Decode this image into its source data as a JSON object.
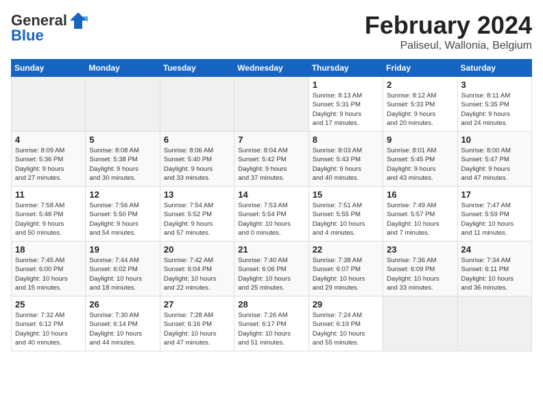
{
  "header": {
    "logo_general": "General",
    "logo_blue": "Blue",
    "month": "February 2024",
    "location": "Paliseul, Wallonia, Belgium"
  },
  "days_of_week": [
    "Sunday",
    "Monday",
    "Tuesday",
    "Wednesday",
    "Thursday",
    "Friday",
    "Saturday"
  ],
  "weeks": [
    [
      {
        "day": "",
        "info": ""
      },
      {
        "day": "",
        "info": ""
      },
      {
        "day": "",
        "info": ""
      },
      {
        "day": "",
        "info": ""
      },
      {
        "day": "1",
        "info": "Sunrise: 8:13 AM\nSunset: 5:31 PM\nDaylight: 9 hours\nand 17 minutes."
      },
      {
        "day": "2",
        "info": "Sunrise: 8:12 AM\nSunset: 5:33 PM\nDaylight: 9 hours\nand 20 minutes."
      },
      {
        "day": "3",
        "info": "Sunrise: 8:11 AM\nSunset: 5:35 PM\nDaylight: 9 hours\nand 24 minutes."
      }
    ],
    [
      {
        "day": "4",
        "info": "Sunrise: 8:09 AM\nSunset: 5:36 PM\nDaylight: 9 hours\nand 27 minutes."
      },
      {
        "day": "5",
        "info": "Sunrise: 8:08 AM\nSunset: 5:38 PM\nDaylight: 9 hours\nand 30 minutes."
      },
      {
        "day": "6",
        "info": "Sunrise: 8:06 AM\nSunset: 5:40 PM\nDaylight: 9 hours\nand 33 minutes."
      },
      {
        "day": "7",
        "info": "Sunrise: 8:04 AM\nSunset: 5:42 PM\nDaylight: 9 hours\nand 37 minutes."
      },
      {
        "day": "8",
        "info": "Sunrise: 8:03 AM\nSunset: 5:43 PM\nDaylight: 9 hours\nand 40 minutes."
      },
      {
        "day": "9",
        "info": "Sunrise: 8:01 AM\nSunset: 5:45 PM\nDaylight: 9 hours\nand 43 minutes."
      },
      {
        "day": "10",
        "info": "Sunrise: 8:00 AM\nSunset: 5:47 PM\nDaylight: 9 hours\nand 47 minutes."
      }
    ],
    [
      {
        "day": "11",
        "info": "Sunrise: 7:58 AM\nSunset: 5:48 PM\nDaylight: 9 hours\nand 50 minutes."
      },
      {
        "day": "12",
        "info": "Sunrise: 7:56 AM\nSunset: 5:50 PM\nDaylight: 9 hours\nand 54 minutes."
      },
      {
        "day": "13",
        "info": "Sunrise: 7:54 AM\nSunset: 5:52 PM\nDaylight: 9 hours\nand 57 minutes."
      },
      {
        "day": "14",
        "info": "Sunrise: 7:53 AM\nSunset: 5:54 PM\nDaylight: 10 hours\nand 0 minutes."
      },
      {
        "day": "15",
        "info": "Sunrise: 7:51 AM\nSunset: 5:55 PM\nDaylight: 10 hours\nand 4 minutes."
      },
      {
        "day": "16",
        "info": "Sunrise: 7:49 AM\nSunset: 5:57 PM\nDaylight: 10 hours\nand 7 minutes."
      },
      {
        "day": "17",
        "info": "Sunrise: 7:47 AM\nSunset: 5:59 PM\nDaylight: 10 hours\nand 11 minutes."
      }
    ],
    [
      {
        "day": "18",
        "info": "Sunrise: 7:45 AM\nSunset: 6:00 PM\nDaylight: 10 hours\nand 15 minutes."
      },
      {
        "day": "19",
        "info": "Sunrise: 7:44 AM\nSunset: 6:02 PM\nDaylight: 10 hours\nand 18 minutes."
      },
      {
        "day": "20",
        "info": "Sunrise: 7:42 AM\nSunset: 6:04 PM\nDaylight: 10 hours\nand 22 minutes."
      },
      {
        "day": "21",
        "info": "Sunrise: 7:40 AM\nSunset: 6:06 PM\nDaylight: 10 hours\nand 25 minutes."
      },
      {
        "day": "22",
        "info": "Sunrise: 7:38 AM\nSunset: 6:07 PM\nDaylight: 10 hours\nand 29 minutes."
      },
      {
        "day": "23",
        "info": "Sunrise: 7:36 AM\nSunset: 6:09 PM\nDaylight: 10 hours\nand 33 minutes."
      },
      {
        "day": "24",
        "info": "Sunrise: 7:34 AM\nSunset: 6:11 PM\nDaylight: 10 hours\nand 36 minutes."
      }
    ],
    [
      {
        "day": "25",
        "info": "Sunrise: 7:32 AM\nSunset: 6:12 PM\nDaylight: 10 hours\nand 40 minutes."
      },
      {
        "day": "26",
        "info": "Sunrise: 7:30 AM\nSunset: 6:14 PM\nDaylight: 10 hours\nand 44 minutes."
      },
      {
        "day": "27",
        "info": "Sunrise: 7:28 AM\nSunset: 6:16 PM\nDaylight: 10 hours\nand 47 minutes."
      },
      {
        "day": "28",
        "info": "Sunrise: 7:26 AM\nSunset: 6:17 PM\nDaylight: 10 hours\nand 51 minutes."
      },
      {
        "day": "29",
        "info": "Sunrise: 7:24 AM\nSunset: 6:19 PM\nDaylight: 10 hours\nand 55 minutes."
      },
      {
        "day": "",
        "info": ""
      },
      {
        "day": "",
        "info": ""
      }
    ]
  ]
}
